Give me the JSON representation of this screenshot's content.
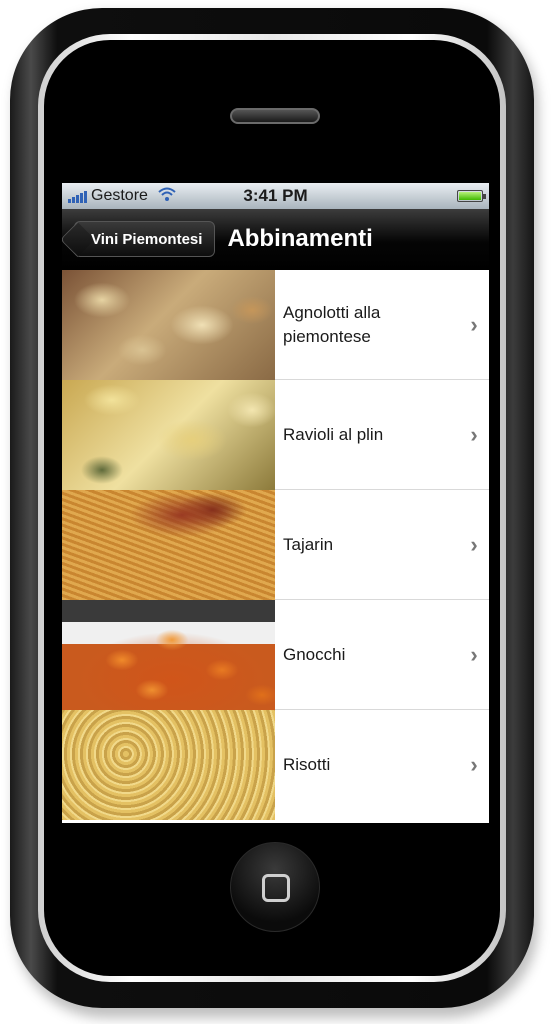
{
  "statusbar": {
    "carrier": "Gestore",
    "time": "3:41 PM",
    "battery_level": 1.0
  },
  "navbar": {
    "back_label": "Vini Piemontesi",
    "title": "Abbinamenti"
  },
  "list": {
    "items": [
      {
        "label": "Agnolotti alla piemontese",
        "icon": "chevron-right-icon"
      },
      {
        "label": "Ravioli al plin",
        "icon": "chevron-right-icon"
      },
      {
        "label": "Tajarin",
        "icon": "chevron-right-icon"
      },
      {
        "label": "Gnocchi",
        "icon": "chevron-right-icon"
      },
      {
        "label": "Risotti",
        "icon": "chevron-right-icon"
      }
    ]
  },
  "chevron": "›",
  "colors": {
    "navbar": "#000000",
    "signal": "#2f62b6",
    "battery": "#3fb800"
  }
}
